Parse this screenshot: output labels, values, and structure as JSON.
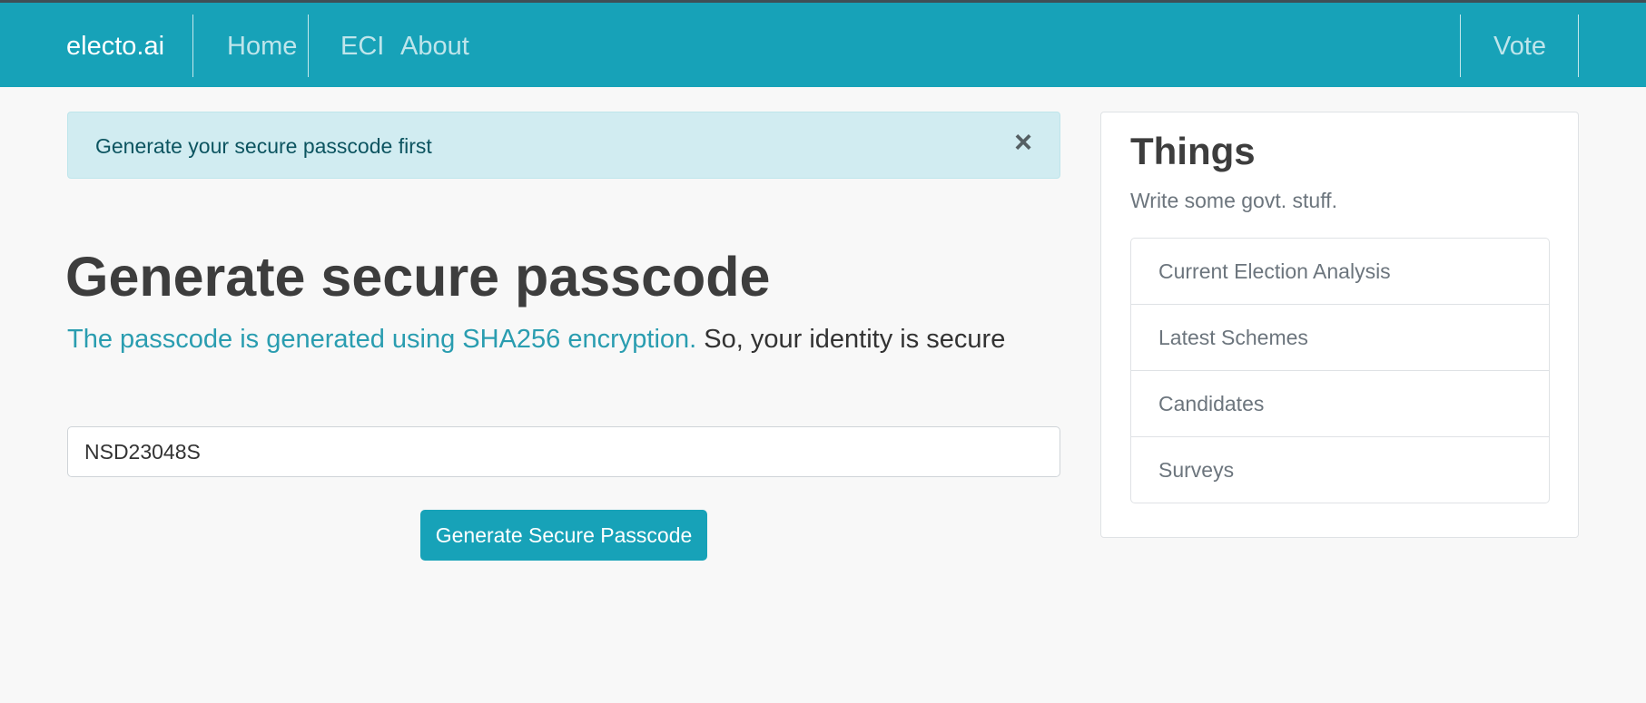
{
  "navbar": {
    "brand": "electo.ai",
    "links": [
      {
        "label": "Home"
      },
      {
        "label": "ECI"
      },
      {
        "label": "About"
      }
    ],
    "vote_label": "Vote"
  },
  "alert": {
    "message": "Generate your secure passcode first",
    "close_symbol": "×"
  },
  "main": {
    "title": "Generate secure passcode",
    "lead_accent": "The passcode is generated using SHA256 encryption.",
    "lead_rest": " So, your identity is secure",
    "passcode_value": "NSD23048S",
    "button_label": "Generate Secure Passcode"
  },
  "sidebar": {
    "title": "Things",
    "subtitle": "Write some govt. stuff.",
    "items": [
      {
        "label": "Current Election Analysis"
      },
      {
        "label": "Latest Schemes"
      },
      {
        "label": "Candidates"
      },
      {
        "label": "Surveys"
      }
    ]
  },
  "colors": {
    "navbar": "#17a2b8",
    "alert_background": "#d1ecf1",
    "alert_text": "#0c5460",
    "lead_accent": "#2a9db0",
    "button": "#17a2b8"
  },
  "icons": {
    "alert_close": "close-icon"
  }
}
